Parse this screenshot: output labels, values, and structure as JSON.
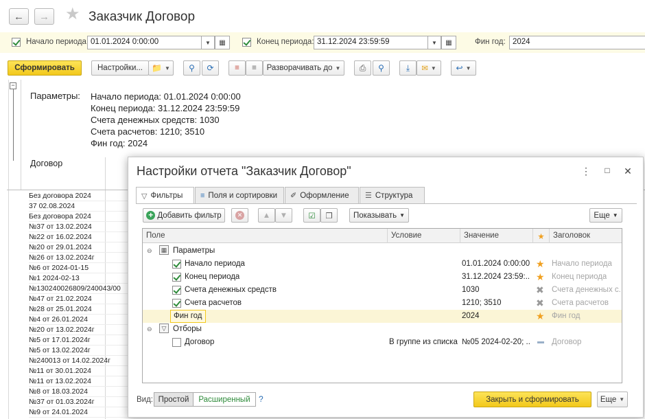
{
  "window": {
    "back_icon": "arrow-left-icon",
    "forward_icon": "arrow-right-icon",
    "title": "Заказчик Договор"
  },
  "period": {
    "start_label": "Начало периода:",
    "start_value": "01.01.2024  0:00:00",
    "start_checked": true,
    "end_label": "Конец периода:",
    "end_value": "31.12.2024 23:59:59",
    "end_checked": true,
    "fin_year_label": "Фин год:",
    "fin_year_value": "2024"
  },
  "toolbar": {
    "generate": "Сформировать",
    "settings": "Настройки...",
    "expand": "Разворачивать до"
  },
  "report": {
    "params_label": "Параметры:",
    "params_lines": [
      "Начало периода: 01.01.2024 0:00:00",
      "Конец периода: 31.12.2024 23:59:59",
      "Счета денежных средств: 1030",
      "Счета расчетов: 1210; 3510",
      "Фин год: 2024"
    ],
    "column_header": "Договор",
    "rows": [
      "Без договора 2024",
      "37   02.08.2024",
      "Без договора 2024",
      "№37 от 13.02.2024",
      "№22 от 16.02.2024",
      "№20 от 29.01.2024",
      "№26 от 13.02.2024г",
      "№6 от 2024-01-15",
      "№1 2024-02-13",
      "№130240026809/240043/00",
      "№47 от 21.02.2024",
      "№28 от 25.01.2024",
      "№4 от 26.01.2024",
      "№20 от 13.02.2024г",
      "№5 от 17.01.2024г",
      "№5 от 13.02.2024г",
      "№240013 от 14.02.2024г",
      "№11 от 30.01.2024",
      "№11 от 13.02.2024",
      "№8 от 18.03.2024",
      "№37 от 01.03.2024г",
      "№9 от 24.01.2024"
    ]
  },
  "dialog": {
    "title": "Настройки отчета \"Заказчик Договор\"",
    "tabs": [
      "Фильтры",
      "Поля и сортировки",
      "Оформление",
      "Структура"
    ],
    "add_filter": "Добавить фильтр",
    "show": "Показывать",
    "more": "Еще",
    "columns": [
      "Поле",
      "Условие",
      "Значение",
      "Заголовок"
    ],
    "group_params": "Параметры",
    "group_filters": "Отборы",
    "params": [
      {
        "field": "Начало периода",
        "value": "01.01.2024 0:00:00",
        "title": "Начало периода",
        "checked": true,
        "mark": "star"
      },
      {
        "field": "Конец периода",
        "value": "31.12.2024 23:59:...",
        "title": "Конец периода",
        "checked": true,
        "mark": "star"
      },
      {
        "field": "Счета денежных средств",
        "value": "1030",
        "title": "Счета денежных с...",
        "checked": true,
        "mark": "cross"
      },
      {
        "field": "Счета расчетов",
        "value": "1210; 3510",
        "title": "Счета расчетов",
        "checked": true,
        "mark": "cross"
      },
      {
        "field": "Фин год",
        "value": "2024",
        "title": "Фин год",
        "checked": false,
        "mark": "star"
      }
    ],
    "filters": [
      {
        "field": "Договор",
        "condition": "В группе из списка",
        "value": "№05 2024-02-20; ...",
        "title": "Договор",
        "checked": false
      }
    ],
    "view_label": "Вид:",
    "view_simple": "Простой",
    "view_advanced": "Расширенный",
    "help": "?",
    "close_and_generate": "Закрыть и сформировать",
    "more_bottom": "Еще"
  }
}
